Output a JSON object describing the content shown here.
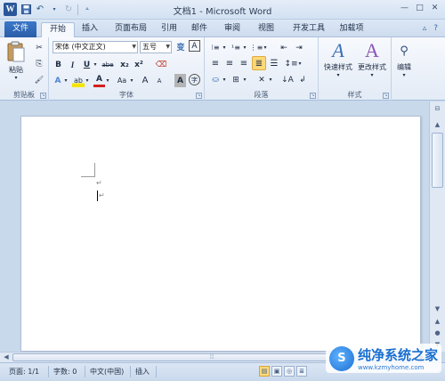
{
  "titlebar": {
    "title": "文档1  -  Microsoft Word",
    "logo_letter": "W",
    "qat": {
      "save_icon": "save-icon",
      "undo_icon": "undo-icon",
      "redo_icon": "redo-icon",
      "customize_icon": "customize-icon"
    },
    "controls": {
      "minimize": "—",
      "restore": "□",
      "close": "✕"
    }
  },
  "tabs": {
    "file": "文件",
    "items": [
      "开始",
      "插入",
      "页面布局",
      "引用",
      "邮件",
      "审阅",
      "视图",
      "开发工具",
      "加载项"
    ],
    "active": "开始"
  },
  "ribbon": {
    "clipboard": {
      "label": "剪贴板",
      "paste": "粘贴",
      "cut": "✂",
      "copy": "⎘",
      "format_painter": "🖌"
    },
    "font": {
      "label": "字体",
      "font_name": "宋体 (中文正文)",
      "font_size": "五号",
      "bold": "B",
      "italic": "I",
      "underline": "U",
      "strike": "abe",
      "subscript": "x₂",
      "superscript": "x²",
      "grow": "A",
      "shrink": "A",
      "change_case": "Aa",
      "clear": "A",
      "text_effects": "A",
      "highlight": "ab",
      "font_color": "A",
      "char_shading": "A",
      "enclose": "字"
    },
    "paragraph": {
      "label": "段落"
    },
    "styles": {
      "label": "样式",
      "quick_styles": "快速样式",
      "change_styles": "更改样式"
    },
    "editing": {
      "label": "编辑",
      "edit": "编辑"
    }
  },
  "document": {
    "paragraph_mark": "↵"
  },
  "status": {
    "page": "页面: 1/1",
    "words": "字数: 0",
    "language": "中文(中国)",
    "mode": "插入"
  },
  "watermark": {
    "logo": "S",
    "title": "纯净系统之家",
    "url": "www.kzmyhome.com"
  },
  "colors": {
    "accent": "#2b579a",
    "file_tab": "#2a5ea8",
    "highlight": "#fbd97a"
  }
}
